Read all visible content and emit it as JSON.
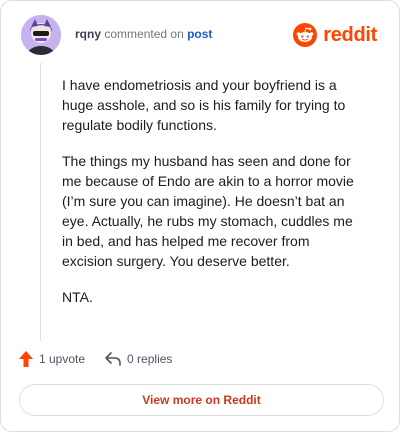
{
  "header": {
    "username": "rqny",
    "verb": "commented on",
    "post_link": "post",
    "brand_name": "reddit"
  },
  "comment": {
    "paragraphs": [
      "I have endometriosis and your boyfriend is a huge asshole, and so is his family for trying to regulate bodily functions.",
      "The things my husband has seen and done for me because of Endo are akin to a horror movie (I’m sure you can imagine). He doesn’t bat an eye. Actually, he rubs my stomach, cuddles me in bed, and has helped me recover from excision surgery. You deserve better.",
      "NTA."
    ]
  },
  "actions": {
    "upvote_label": "1 upvote",
    "replies_label": "0 replies"
  },
  "footer": {
    "view_more_label": "View more on Reddit"
  },
  "icons": {
    "upvote": "upvote-arrow-icon",
    "reply": "reply-arrow-icon",
    "brand": "reddit-logo-icon",
    "avatar": "user-avatar"
  },
  "colors": {
    "brand": "#ff4500",
    "link": "#1c5cc8",
    "view_more_text": "#c6391c",
    "upvote_arrow": "#ff4500"
  }
}
